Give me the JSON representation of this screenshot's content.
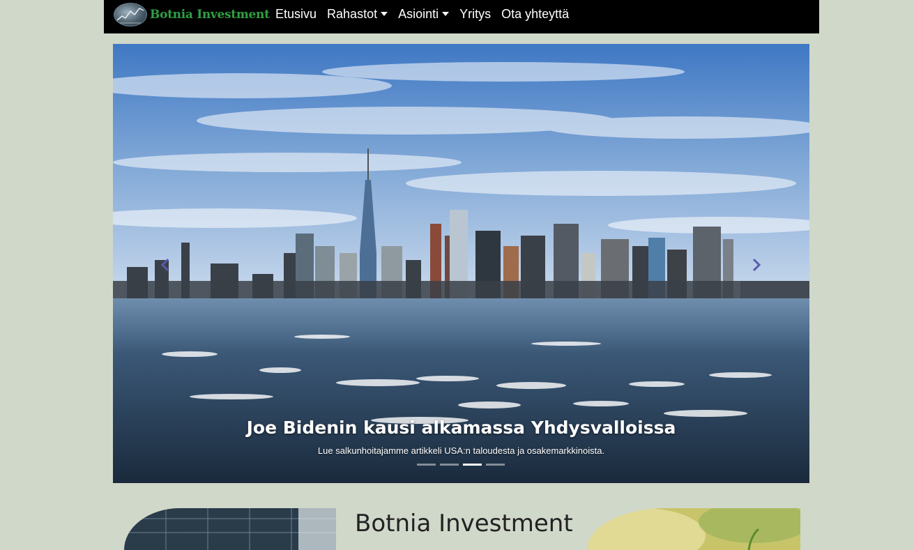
{
  "nav": {
    "brand": "Botnia Investment",
    "links": [
      {
        "label": "Etusivu",
        "dropdown": false
      },
      {
        "label": "Rahastot",
        "dropdown": true
      },
      {
        "label": "Asiointi",
        "dropdown": true
      },
      {
        "label": "Yritys",
        "dropdown": false
      },
      {
        "label": "Ota yhteyttä",
        "dropdown": false
      }
    ]
  },
  "carousel": {
    "caption_title": "Joe Bidenin kausi alkamassa Yhdysvalloissa",
    "caption_text": "Lue salkunhoitajamme artikkeli USA:n taloudesta ja osakemarkkinoista.",
    "active_index": 2,
    "slide_count": 4
  },
  "section": {
    "title": "Botnia Investment"
  },
  "colors": {
    "page_bg": "#d0d8ca",
    "navbar_bg": "#000000",
    "brand_green": "#2fa043",
    "control_icon": "#5a5ab0"
  },
  "icons": {
    "prev": "chevron-left-icon",
    "next": "chevron-right-icon",
    "dropdown": "caret-down-icon"
  }
}
